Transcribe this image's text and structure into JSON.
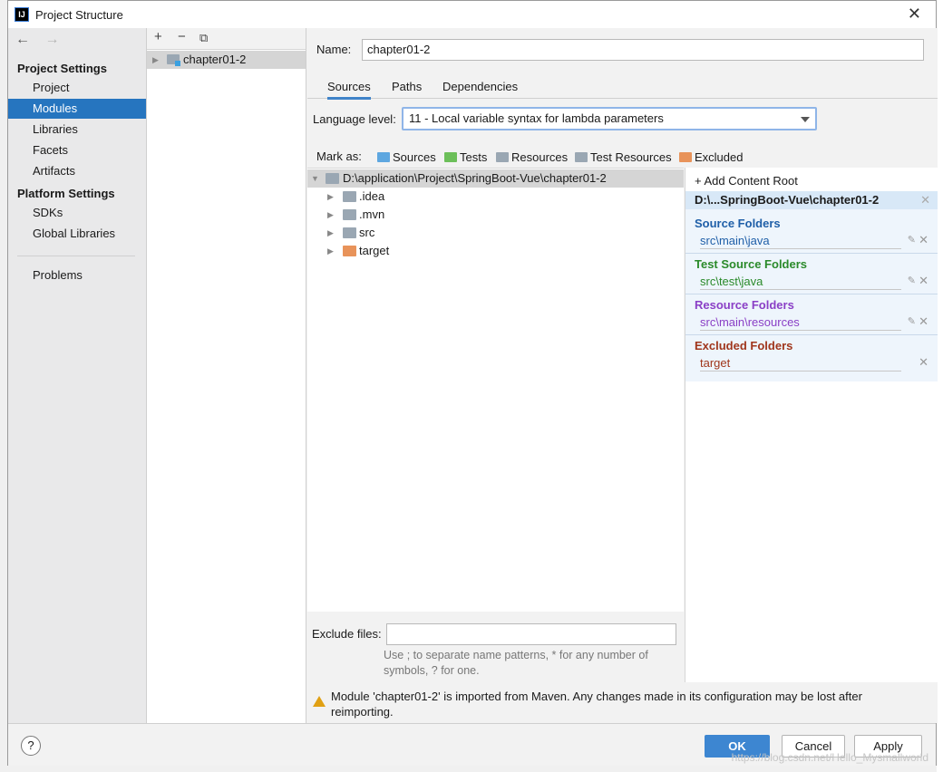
{
  "window": {
    "title": "Project Structure",
    "app_icon_text": "IJ",
    "close_label": "✕"
  },
  "nav": {
    "back": "←",
    "forward": "→",
    "project_settings": "Project Settings",
    "project_items": [
      "Project",
      "Modules",
      "Libraries",
      "Facets",
      "Artifacts"
    ],
    "platform_settings": "Platform Settings",
    "platform_items": [
      "SDKs",
      "Global Libraries"
    ],
    "problems": "Problems",
    "selected": "Modules"
  },
  "modules": {
    "toolbar": {
      "add": "+",
      "remove": "−",
      "copy": "⧉"
    },
    "items": [
      "chapter01-2"
    ]
  },
  "main": {
    "name_label": "Name:",
    "name_value": "chapter01-2",
    "tabs": [
      "Sources",
      "Paths",
      "Dependencies"
    ],
    "selected_tab": "Sources",
    "language_level_label": "Language level:",
    "language_level_value": "11 - Local variable syntax for lambda parameters",
    "mark_as_label": "Mark as:",
    "mark_as": [
      {
        "label": "Sources",
        "color": "#5ea7e0"
      },
      {
        "label": "Tests",
        "color": "#6cbf5a"
      },
      {
        "label": "Resources",
        "color": "#9aa7b3"
      },
      {
        "label": "Test Resources",
        "color": "#9aa7b3"
      },
      {
        "label": "Excluded",
        "color": "#e8935a"
      }
    ],
    "tree": {
      "root": "D:\\application\\Project\\SpringBoot-Vue\\chapter01-2",
      "children": [
        {
          "label": ".idea",
          "color": "#9aa7b3"
        },
        {
          "label": ".mvn",
          "color": "#9aa7b3"
        },
        {
          "label": "src",
          "color": "#9aa7b3"
        },
        {
          "label": "target",
          "color": "#e8935a"
        }
      ]
    },
    "content_root": {
      "add_label": "+ Add Content Root",
      "root_path": "D:\\...SpringBoot-Vue\\chapter01-2",
      "source_folders": {
        "title": "Source Folders",
        "color": "#1f5fa8",
        "path": "src\\main\\java"
      },
      "test_source_folders": {
        "title": "Test Source Folders",
        "color": "#2a8a2a",
        "path": "src\\test\\java"
      },
      "resource_folders": {
        "title": "Resource Folders",
        "color": "#8a3fc6",
        "path": "src\\main\\resources"
      },
      "excluded_folders": {
        "title": "Excluded Folders",
        "color": "#a0361c",
        "path": "target"
      }
    },
    "exclude_files_label": "Exclude files:",
    "exclude_files_value": "",
    "exclude_hint_1": "Use ; to separate name patterns, * for any number of",
    "exclude_hint_2": "symbols, ? for one.",
    "warning": "Module 'chapter01-2' is imported from Maven. Any changes made in its configuration may be lost after reimporting."
  },
  "buttons": {
    "help": "?",
    "ok": "OK",
    "cancel": "Cancel",
    "apply": "Apply"
  },
  "watermark": "https://blog.csdn.net/Hello_Mysmallworld"
}
